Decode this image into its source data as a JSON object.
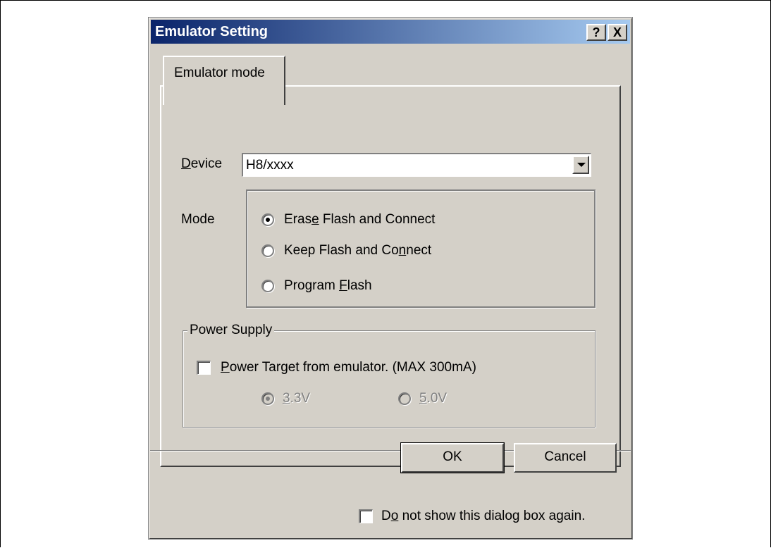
{
  "window": {
    "title": "Emulator Setting",
    "help_glyph": "?",
    "close_glyph": "X"
  },
  "tabs": [
    {
      "label": "Emulator mode",
      "selected": true
    }
  ],
  "device": {
    "label": "Device",
    "label_mnemonic_index": 0,
    "value": "H8/xxxx"
  },
  "mode": {
    "label": "Mode",
    "options": [
      {
        "label": "Erase Flash and Connect",
        "mnemonic_index": 4,
        "checked": true
      },
      {
        "label": "Keep Flash and Connect",
        "mnemonic_index": 17,
        "checked": false
      },
      {
        "label": "Program Flash",
        "mnemonic_index": 8,
        "checked": false
      }
    ]
  },
  "power_supply": {
    "legend": "Power Supply",
    "checkbox_label": "Power Target from emulator. (MAX 300mA)",
    "checkbox_mnemonic_index": 0,
    "checkbox_checked": false,
    "voltages": [
      {
        "label": "3.3V",
        "checked": true,
        "enabled": false
      },
      {
        "label": "5.0V",
        "checked": false,
        "enabled": false
      }
    ]
  },
  "buttons": {
    "ok": "OK",
    "cancel": "Cancel"
  },
  "footer": {
    "dont_show_label": "Do not show this dialog box again.",
    "dont_show_mnemonic_index": 1,
    "dont_show_checked": false
  },
  "colors": {
    "dialog_face": "#d4d0c8",
    "title_start": "#0a246a",
    "title_end": "#a6caf0"
  }
}
